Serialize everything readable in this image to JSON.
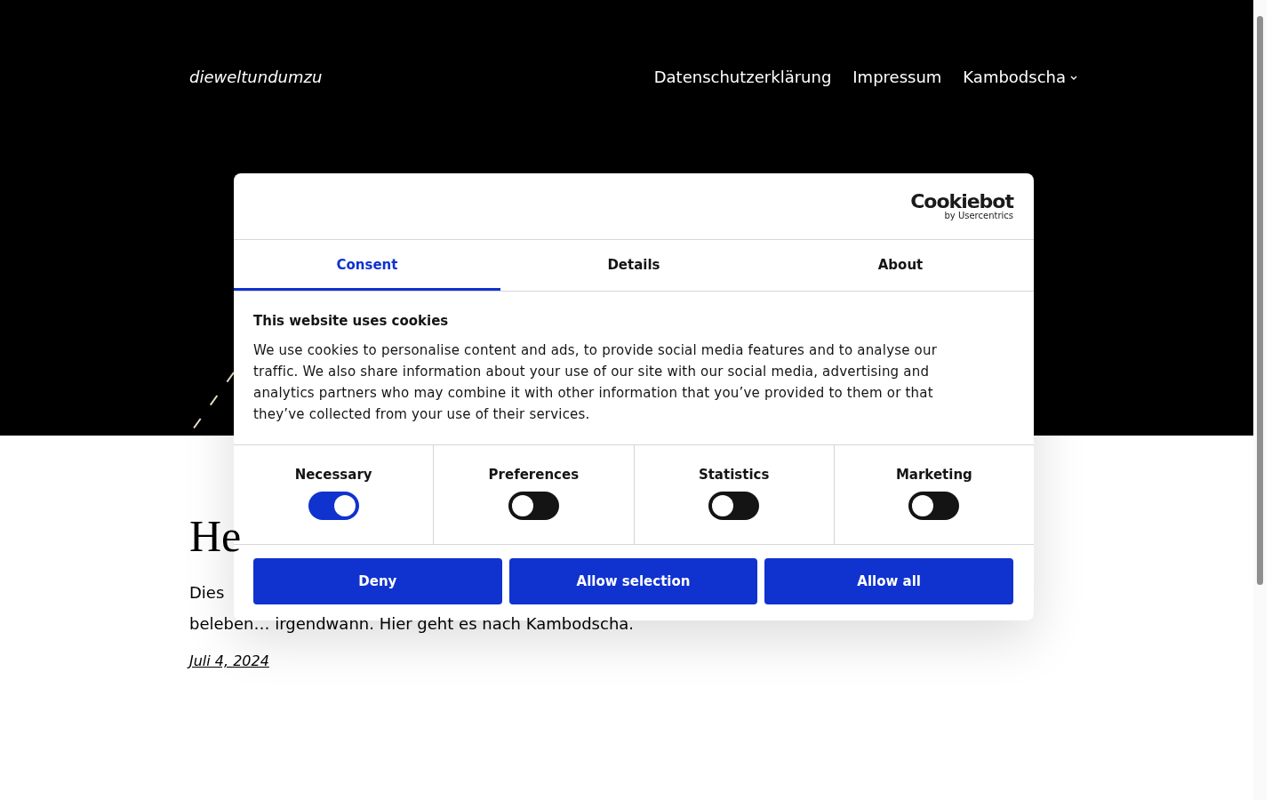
{
  "site": {
    "title": "dieweltundumzu",
    "nav": [
      {
        "label": "Datenschutzerklärung",
        "kind": "link"
      },
      {
        "label": "Impressum",
        "kind": "link"
      },
      {
        "label": "Kambodscha",
        "kind": "dropdown"
      }
    ]
  },
  "post": {
    "heading": "He",
    "excerpt_start": "Dies",
    "excerpt_end": "beleben… irgendwann. Hier geht es nach Kambodscha.",
    "date": "Juli 4, 2024"
  },
  "cookie_dialog": {
    "logo": {
      "name": "Cookiebot",
      "tagline": "by Usercentrics"
    },
    "tabs": [
      {
        "label": "Consent",
        "selected": true
      },
      {
        "label": "Details",
        "selected": false
      },
      {
        "label": "About",
        "selected": false
      }
    ],
    "title": "This website uses cookies",
    "text": "We use cookies to personalise content and ads, to provide social media features and to analyse our traffic. We also share information about your use of our site with our social media, advertising and analytics partners who may combine it with other information that you’ve provided to them or that they’ve collected from your use of their services.",
    "categories": [
      {
        "label": "Necessary",
        "checked": true
      },
      {
        "label": "Preferences",
        "checked": false
      },
      {
        "label": "Statistics",
        "checked": false
      },
      {
        "label": "Marketing",
        "checked": false
      }
    ],
    "buttons": [
      "Deny",
      "Allow selection",
      "Allow all"
    ]
  }
}
